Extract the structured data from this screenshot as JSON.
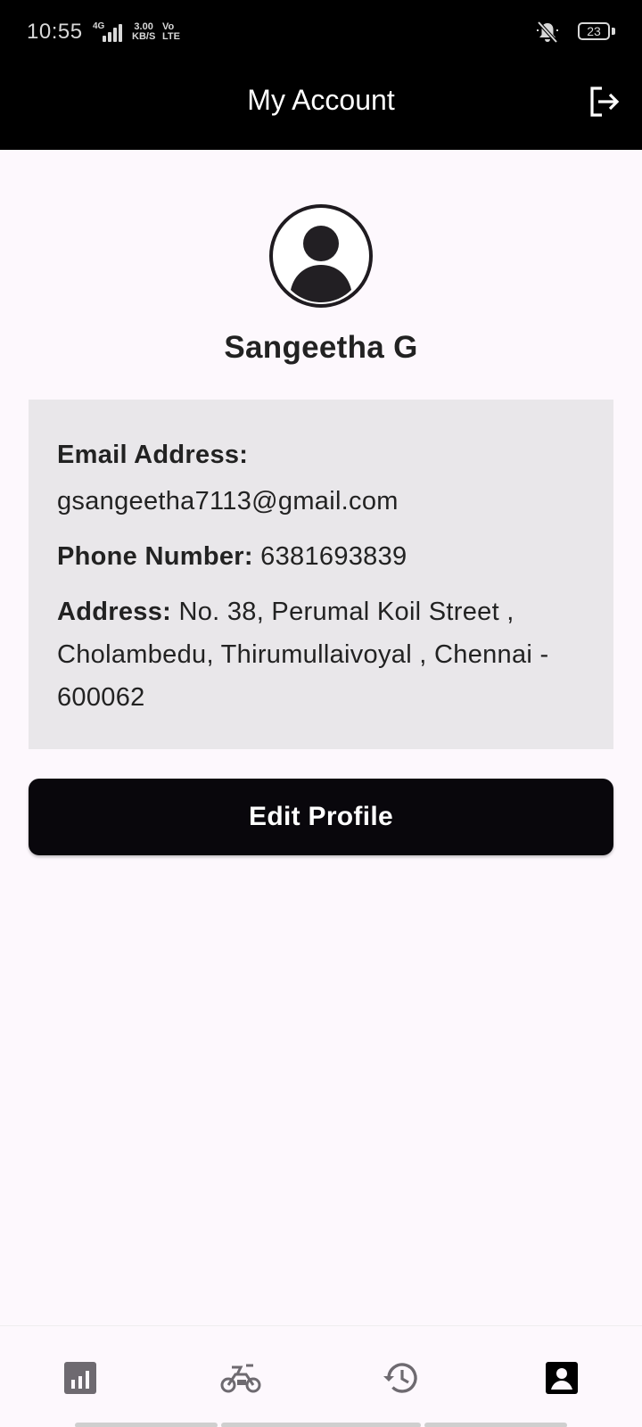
{
  "status_bar": {
    "time": "10:55",
    "network_type": "4G",
    "speed_value": "3.00",
    "speed_unit": "KB/S",
    "volte_top": "Vo",
    "volte_bottom": "LTE",
    "battery_level": "23",
    "icons": [
      "signal-icon",
      "bell-muted-icon",
      "battery-icon"
    ]
  },
  "app_bar": {
    "title": "My Account",
    "action_icon": "logout-icon"
  },
  "profile": {
    "avatar_icon": "account-circle-icon",
    "name": "Sangeetha G"
  },
  "details": {
    "email_label": "Email Address:",
    "email_value": "gsangeetha7113@gmail.com",
    "phone_label": "Phone Number:",
    "phone_value": "6381693839",
    "address_label": "Address:",
    "address_value": "No. 38, Perumal Koil Street , Cholambedu, Thirumullaivoyal , Chennai - 600062"
  },
  "actions": {
    "edit_profile_label": "Edit Profile"
  },
  "bottom_nav": {
    "items": [
      {
        "icon": "bar-chart-icon",
        "active": false
      },
      {
        "icon": "vehicle-icon",
        "active": false
      },
      {
        "icon": "history-icon",
        "active": false
      },
      {
        "icon": "account-box-icon",
        "active": true
      }
    ]
  },
  "colors": {
    "app_bar_bg": "#000000",
    "page_bg": "#fdf8fd",
    "card_bg": "#e9e7ea",
    "button_bg": "#09070c",
    "nav_inactive": "#6e6a70",
    "nav_active": "#000000"
  }
}
